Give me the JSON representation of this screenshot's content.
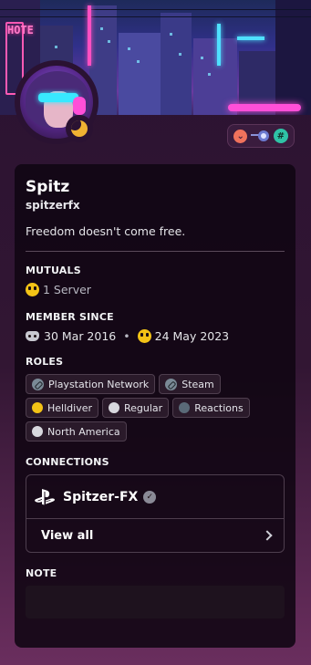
{
  "profile": {
    "display_name": "Spitz",
    "username": "spitzerfx",
    "about": "Freedom doesn't come free.",
    "status": "moon-idle-icon"
  },
  "banner": {
    "sign_text": "HOTE"
  },
  "badges": [
    "red-heart-badge-icon",
    "speed-orb-badge-icon",
    "hash-badge-icon"
  ],
  "mutuals": {
    "title": "MUTUALS",
    "server_count": "1 Server"
  },
  "member_since": {
    "title": "MEMBER SINCE",
    "discord_date": "30 Mar 2016",
    "separator": "•",
    "server_date": "24 May 2023"
  },
  "roles": {
    "title": "ROLES",
    "items": [
      {
        "label": "Playstation Network",
        "icon": "link-icon",
        "color": "#7a8a96"
      },
      {
        "label": "Steam",
        "icon": "link-icon",
        "color": "#7a8a96"
      },
      {
        "label": "Helldiver",
        "icon": "dot",
        "color": "#f3c316"
      },
      {
        "label": "Regular",
        "icon": "dot",
        "color": "#d8d8de"
      },
      {
        "label": "Reactions",
        "icon": "dot",
        "color": "#5a6a78"
      },
      {
        "label": "North America",
        "icon": "dot",
        "color": "#d8d8de"
      }
    ]
  },
  "connections": {
    "title": "CONNECTIONS",
    "account_name": "Spitzer-FX",
    "platform_icon": "playstation-icon",
    "verified_mark": "✓",
    "view_all": "View all"
  },
  "note": {
    "title": "NOTE",
    "value": ""
  },
  "colors": {
    "accent_pink": "#ff4fd8",
    "status_idle": "#f0b232",
    "panel_bg": "#10060f"
  }
}
